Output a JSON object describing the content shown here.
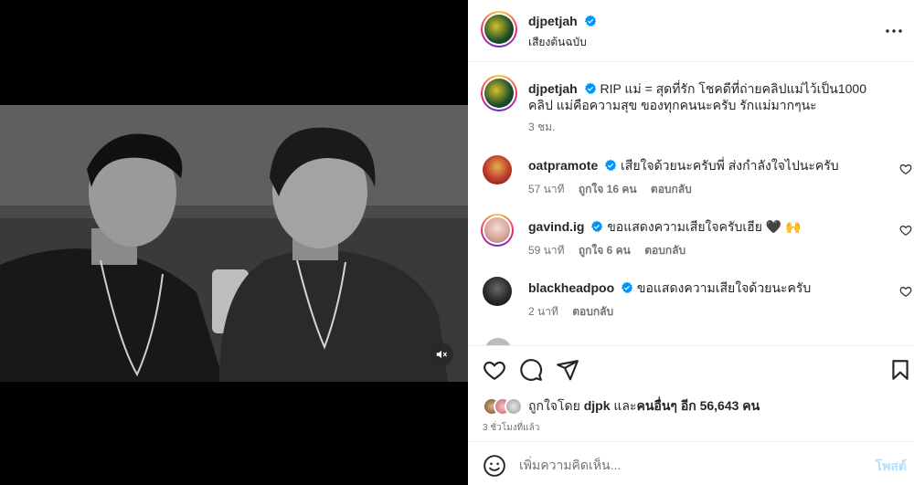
{
  "post": {
    "username": "djpetjah",
    "audio_label": "เสียงต้นฉบับ",
    "caption": "RIP แม่ = สุดที่รัก โชคดีที่ถ่ายคลิปแม่ไว้เป็น1000 คลิป แม่คือความสุข ของทุกคนนะครับ รักแม่มากๆนะ",
    "caption_time": "3 ชม."
  },
  "comments": [
    {
      "username": "oatpramote",
      "text": "เสียใจด้วยนะครับพี่ ส่งกำลังใจไปนะครับ",
      "time": "57 นาที",
      "likes": "ถูกใจ 16 คน",
      "reply": "ตอบกลับ",
      "avatar_color": "#c0392b"
    },
    {
      "username": "gavind.ig",
      "text": "ขอแสดงความเสียใจครับเฮีย 🖤 🙌",
      "time": "59 นาที",
      "likes": "ถูกใจ 6 คน",
      "reply": "ตอบกลับ",
      "avatar_color": "#d8a8a0"
    },
    {
      "username": "blackheadpoo",
      "text": "ขอแสดงความเสียใจด้วยนะครับ",
      "time": "2 นาที",
      "reply": "ตอบกลับ",
      "avatar_color": "#1c1c1c"
    }
  ],
  "likes": {
    "prefix": "ถูกใจโดย",
    "user": "djpk",
    "middle": "และ",
    "others": "คนอื่นๆ อีก 56,643 คน"
  },
  "post_time": "3 ชั่วโมงที่แล้ว",
  "add_comment": {
    "placeholder": "เพิ่มความคิดเห็น...",
    "post_label": "โพสต์"
  },
  "colors": {
    "verified": "#0095f6",
    "accent": "#0095f6",
    "muted": "#737373"
  }
}
